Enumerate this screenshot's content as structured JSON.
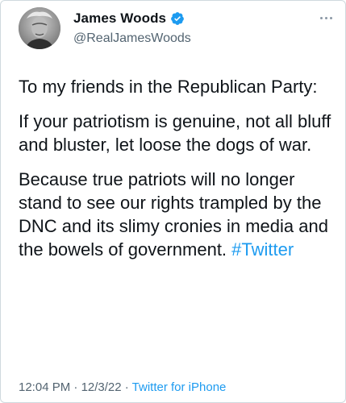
{
  "author": {
    "name": "James Woods",
    "handle": "@RealJamesWoods",
    "verified": true
  },
  "tweet": {
    "paragraph1": "To my friends in the Republican Party:",
    "paragraph2": "If your patriotism is genuine, not all bluff and bluster, let loose the dogs of war.",
    "paragraph3": "Because true patriots will no longer stand to see our rights trampled by the DNC and its slimy cronies in media and the bowels of government.",
    "hashtag": "#Twitter"
  },
  "meta": {
    "time": "12:04 PM",
    "separator1": " · ",
    "date": "12/3/22",
    "separator2": " · ",
    "source": "Twitter for iPhone"
  },
  "colors": {
    "accent": "#1d9bf0",
    "text": "#0f1419",
    "secondary": "#536471"
  },
  "icons": {
    "verified": "verified-badge-icon",
    "more": "more-options-icon"
  }
}
